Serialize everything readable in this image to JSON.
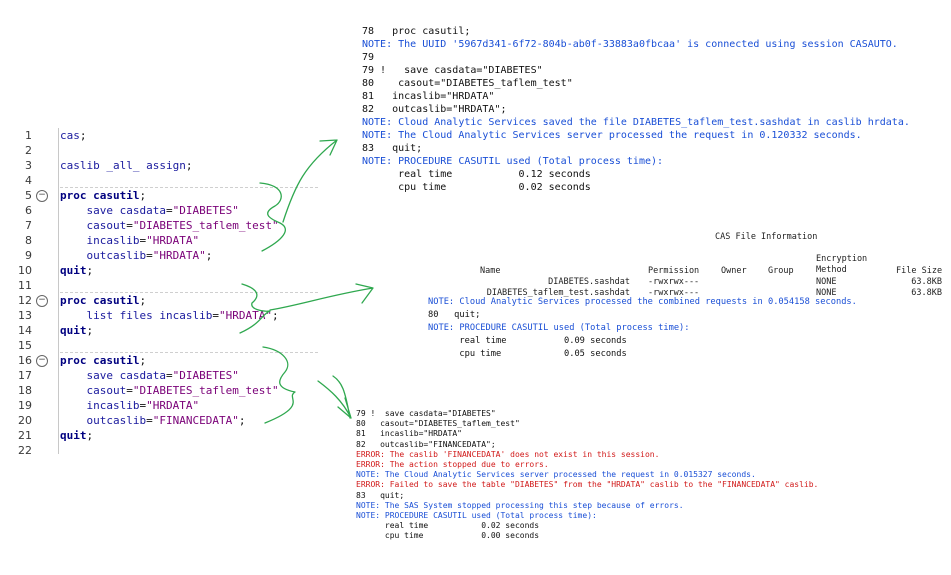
{
  "editor": {
    "lines": [
      {
        "num": "1",
        "text": "cas;"
      },
      {
        "num": "2",
        "text": ""
      },
      {
        "num": "3",
        "text": "caslib _all_ assign;"
      },
      {
        "num": "4",
        "text": ""
      },
      {
        "num": "5",
        "text": "proc casutil;"
      },
      {
        "num": "6",
        "text": "    save casdata=\"DIABETES\""
      },
      {
        "num": "7",
        "text": "    casout=\"DIABETES_taflem_test\""
      },
      {
        "num": "8",
        "text": "    incaslib=\"HRDATA\""
      },
      {
        "num": "9",
        "text": "    outcaslib=\"HRDATA\";"
      },
      {
        "num": "10",
        "text": "quit;"
      },
      {
        "num": "11",
        "text": ""
      },
      {
        "num": "12",
        "text": "proc casutil;"
      },
      {
        "num": "13",
        "text": "    list files incaslib=\"HRDATA\";"
      },
      {
        "num": "14",
        "text": "quit;"
      },
      {
        "num": "15",
        "text": ""
      },
      {
        "num": "16",
        "text": "proc casutil;"
      },
      {
        "num": "17",
        "text": "    save casdata=\"DIABETES\""
      },
      {
        "num": "18",
        "text": "    casout=\"DIABETES_taflem_test\""
      },
      {
        "num": "19",
        "text": "    incaslib=\"HRDATA\""
      },
      {
        "num": "20",
        "text": "    outcaslib=\"FINANCEDATA\";"
      },
      {
        "num": "21",
        "text": "quit;"
      },
      {
        "num": "22",
        "text": ""
      }
    ]
  },
  "log1": [
    {
      "t": "plain",
      "text": "78   proc casutil;"
    },
    {
      "t": "note",
      "text": "NOTE: The UUID '5967d341-6f72-804b-ab0f-33883a0fbcaa' is connected using session CASAUTO."
    },
    {
      "t": "plain",
      "text": "79"
    },
    {
      "t": "plain",
      "text": "79 !   save casdata=\"DIABETES\""
    },
    {
      "t": "plain",
      "text": "80    casout=\"DIABETES_taflem_test\""
    },
    {
      "t": "plain",
      "text": "81   incaslib=\"HRDATA\""
    },
    {
      "t": "plain",
      "text": "82   outcaslib=\"HRDATA\";"
    },
    {
      "t": "note",
      "text": "NOTE: Cloud Analytic Services saved the file DIABETES_taflem_test.sashdat in caslib hrdata."
    },
    {
      "t": "note",
      "text": "NOTE: The Cloud Analytic Services server processed the request in 0.120332 seconds."
    },
    {
      "t": "plain",
      "text": "83   quit;"
    },
    {
      "t": "note",
      "text": "NOTE: PROCEDURE CASUTIL used (Total process time):"
    },
    {
      "t": "plain",
      "text": "      real time           0.12 seconds"
    },
    {
      "t": "plain",
      "text": "      cpu time            0.02 seconds"
    }
  ],
  "table": {
    "title": "CAS File Information",
    "headers": {
      "name": "Name",
      "permission": "Permission",
      "owner": "Owner",
      "group": "Group",
      "encryption": "Encryption\nMethod",
      "filesize": "File Size"
    },
    "rows": [
      {
        "name": "DIABETES.sashdat",
        "permission": "-rwxrwx---",
        "owner": "",
        "group": "",
        "encryption": "NONE",
        "filesize": "63.8KB"
      },
      {
        "name": "DIABETES_taflem_test.sashdat",
        "permission": "-rwxrwx---",
        "owner": "",
        "group": "",
        "encryption": "NONE",
        "filesize": "63.8KB"
      }
    ]
  },
  "log2": [
    {
      "t": "note",
      "text": "NOTE: Cloud Analytic Services processed the combined requests in 0.054158 seconds."
    },
    {
      "t": "plain",
      "text": "80   quit;"
    },
    {
      "t": "note",
      "text": "NOTE: PROCEDURE CASUTIL used (Total process time):"
    },
    {
      "t": "plain",
      "text": "      real time           0.09 seconds"
    },
    {
      "t": "plain",
      "text": "      cpu time            0.05 seconds"
    }
  ],
  "log3": [
    {
      "t": "plain",
      "text": "79 !  save casdata=\"DIABETES\""
    },
    {
      "t": "plain",
      "text": "80   casout=\"DIABETES_taflem_test\""
    },
    {
      "t": "plain",
      "text": "81   incaslib=\"HRDATA\""
    },
    {
      "t": "plain",
      "text": "82   outcaslib=\"FINANCEDATA\";"
    },
    {
      "t": "err",
      "text": "ERROR: The caslib 'FINANCEDATA' does not exist in this session."
    },
    {
      "t": "err",
      "text": "ERROR: The action stopped due to errors."
    },
    {
      "t": "note",
      "text": "NOTE: The Cloud Analytic Services server processed the request in 0.015327 seconds."
    },
    {
      "t": "err",
      "text": "ERROR: Failed to save the table \"DIABETES\" from the \"HRDATA\" caslib to the \"FINANCEDATA\" caslib."
    },
    {
      "t": "plain",
      "text": "83   quit;"
    },
    {
      "t": "note",
      "text": "NOTE: The SAS System stopped processing this step because of errors."
    },
    {
      "t": "note",
      "text": "NOTE: PROCEDURE CASUTIL used (Total process time):"
    },
    {
      "t": "plain",
      "text": "      real time           0.02 seconds"
    },
    {
      "t": "plain",
      "text": "      cpu time            0.00 seconds"
    }
  ],
  "colors": {
    "note": "#1a4fd6",
    "error": "#d11a1a",
    "annotation": "#2fa84f",
    "keyword": "#000080",
    "string": "#7a0078"
  }
}
